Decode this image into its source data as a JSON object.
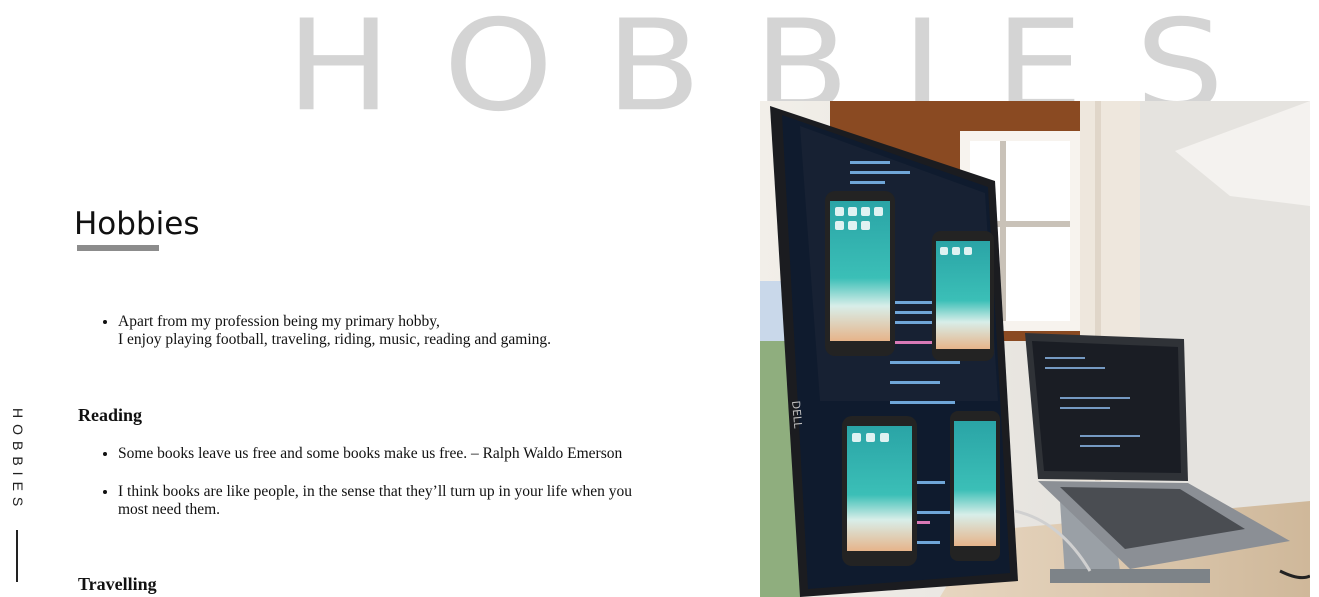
{
  "background_title": "HOBBIES",
  "side_nav": {
    "label": "HOBBIES"
  },
  "section": {
    "title": "Hobbies",
    "intro_line1": "Apart from my profession being my primary hobby,",
    "intro_line2": "I enjoy playing football, traveling, riding, music, reading and gaming."
  },
  "reading": {
    "title": "Reading",
    "items": [
      "Some books leave us free and some books make us free. – Ralph Waldo Emerson",
      "I think books are like people, in the sense that they’ll turn up in your life when you most need them."
    ]
  },
  "travelling": {
    "title": "Travelling"
  },
  "photo": {
    "monitor_brand": "DELL"
  },
  "colors": {
    "background_title": "#d4d4d4",
    "underline": "#8c8c8c",
    "text": "#111111"
  }
}
